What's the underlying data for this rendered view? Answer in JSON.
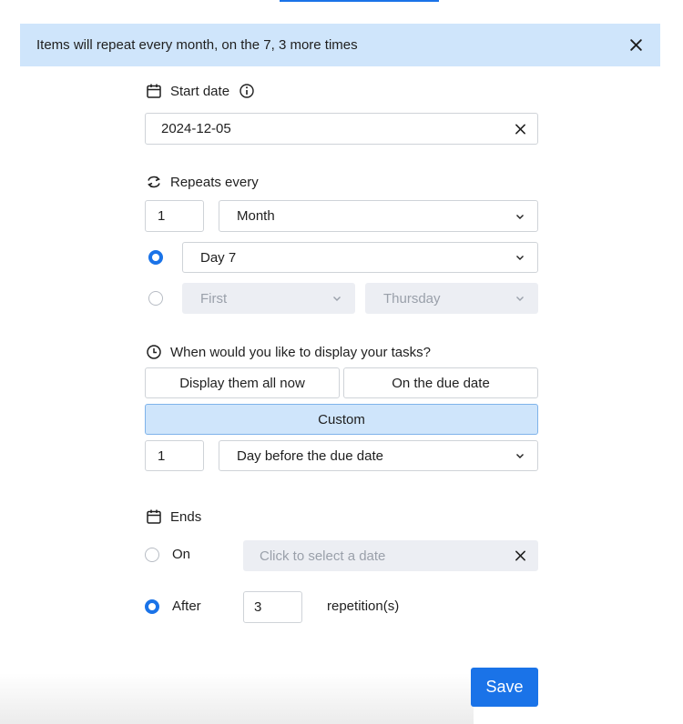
{
  "banner": {
    "message": "Items will repeat every month, on the 7, 3 more times",
    "close_icon": "close-icon"
  },
  "start_date": {
    "label": "Start date",
    "icon": "calendar-icon",
    "info_icon": "info-icon",
    "value": "2024-12-05"
  },
  "repeats": {
    "label": "Repeats every",
    "icon": "repeat-icon",
    "interval_value": "1",
    "unit_selected": "Month",
    "option_day": {
      "selected": true,
      "value": "Day 7"
    },
    "option_weekday": {
      "selected": false,
      "ordinal": "First",
      "weekday": "Thursday"
    }
  },
  "display": {
    "label": "When would you like to display your tasks?",
    "icon": "clock-icon",
    "btn_all_now": "Display them all now",
    "btn_due_date": "On the due date",
    "btn_custom": "Custom",
    "selected": "Custom",
    "custom_value": "1",
    "custom_unit": "Day before the due date"
  },
  "ends": {
    "label": "Ends",
    "icon": "calendar-icon",
    "on_label": "On",
    "on_selected": false,
    "on_placeholder": "Click to select a date",
    "after_label": "After",
    "after_selected": true,
    "after_value": "3",
    "after_suffix": "repetition(s)"
  },
  "save_label": "Save",
  "colors": {
    "accent": "#1a73e8",
    "banner_bg": "#cfe5fb",
    "disabled_bg": "#eceef3"
  }
}
